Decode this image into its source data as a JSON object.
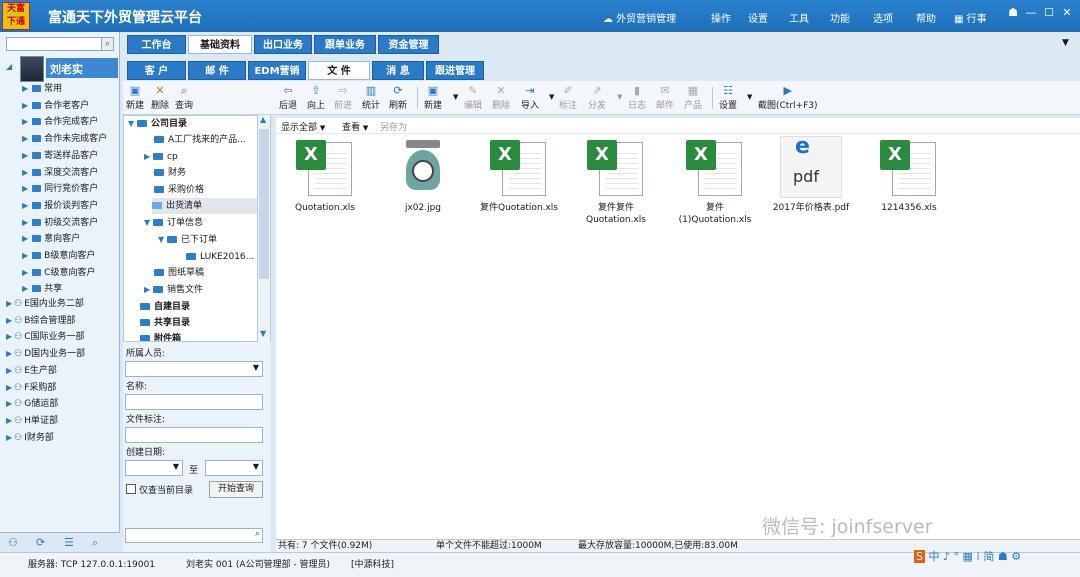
{
  "app": {
    "logo_text": "天富下通",
    "title": "富通天下外贸管理云平台",
    "cloud_link": "外贸营销管理",
    "menu": [
      "操作",
      "设置",
      "工具",
      "功能",
      "选项",
      "帮助"
    ],
    "task_label": "行事"
  },
  "left_panel": {
    "search_placeholder": "",
    "user": "刘老实",
    "items": [
      "常用",
      "合作老客户",
      "合作完成客户",
      "合作未完成客户",
      "寄送样品客户",
      "深度交流客户",
      "同行竞价客户",
      "报价谈判客户",
      "初级交流客户",
      "意向客户",
      "B级意向客户",
      "C级意向客户",
      "共享"
    ],
    "departments": [
      "E国内业务二部",
      "B综合管理部",
      "C国际业务一部",
      "D国内业务一部",
      "E生产部",
      "F采购部",
      "G储运部",
      "H单证部",
      "I财务部"
    ]
  },
  "tabs_row1": [
    "工作台",
    "基础资料",
    "出口业务",
    "跟单业务",
    "资金管理"
  ],
  "tabs_row2": [
    "客 户",
    "邮 件",
    "EDM营销",
    "文 件",
    "消 息",
    "跟进管理"
  ],
  "toolbar": {
    "left": [
      "新建",
      "删除",
      "查询"
    ],
    "main": [
      "后退",
      "向上",
      "前进",
      "统计",
      "刷新",
      "新建",
      "编辑",
      "删除",
      "导入",
      "标注",
      "分发",
      "日志",
      "邮件",
      "产品",
      "设置",
      "截图(Ctrl+F3)"
    ]
  },
  "folder_tree": [
    "公司目录",
    "A工厂找来的产品...",
    "cp",
    "财务",
    "采购价格",
    "出货清单",
    "订单信息",
    "已下订单",
    "LUKE2016...",
    "图纸草稿",
    "销售文件",
    "自建目录",
    "共享目录",
    "附件箱"
  ],
  "query_form": {
    "owner_label": "所属人员:",
    "name_label": "名称:",
    "note_label": "文件标注:",
    "date_label": "创建日期:",
    "to_label": "至",
    "only_current": "仅查当前目录",
    "search_button": "开始查询"
  },
  "file_bar": {
    "show_all": "显示全部",
    "view": "查看",
    "save_as": "另存为"
  },
  "files": [
    {
      "name": "Quotation.xls",
      "type": "xls"
    },
    {
      "name": "jx02.jpg",
      "type": "jpg"
    },
    {
      "name": "复件Quotation.xls",
      "type": "xls"
    },
    {
      "name": "复件复件Quotation.xls",
      "type": "xls"
    },
    {
      "name": "复件(1)Quotation.xls",
      "type": "xls"
    },
    {
      "name": "2017年价格表.pdf",
      "type": "pdf"
    },
    {
      "name": "1214356.xls",
      "type": "xls"
    }
  ],
  "file_status": {
    "total": "共有: 7 个文件(0.92M)",
    "single_limit": "单个文件不能超过:1000M",
    "capacity": "最大存放容量:10000M,已使用:83.00M"
  },
  "status_bar": {
    "server": "服务器: TCP  127.0.0.1:19001",
    "user": "刘老实 001 (A公司管理部 - 管理员)",
    "company": "[中源科技]"
  },
  "watermark": "微信号: joinfserver",
  "tray": "中 ♪ ° ▦ ⁞ 简 ☗ ⚙",
  "colors": {
    "accent": "#2a7ac8",
    "titlebar": "#1f6fb8",
    "excel": "#2a8a3d"
  }
}
